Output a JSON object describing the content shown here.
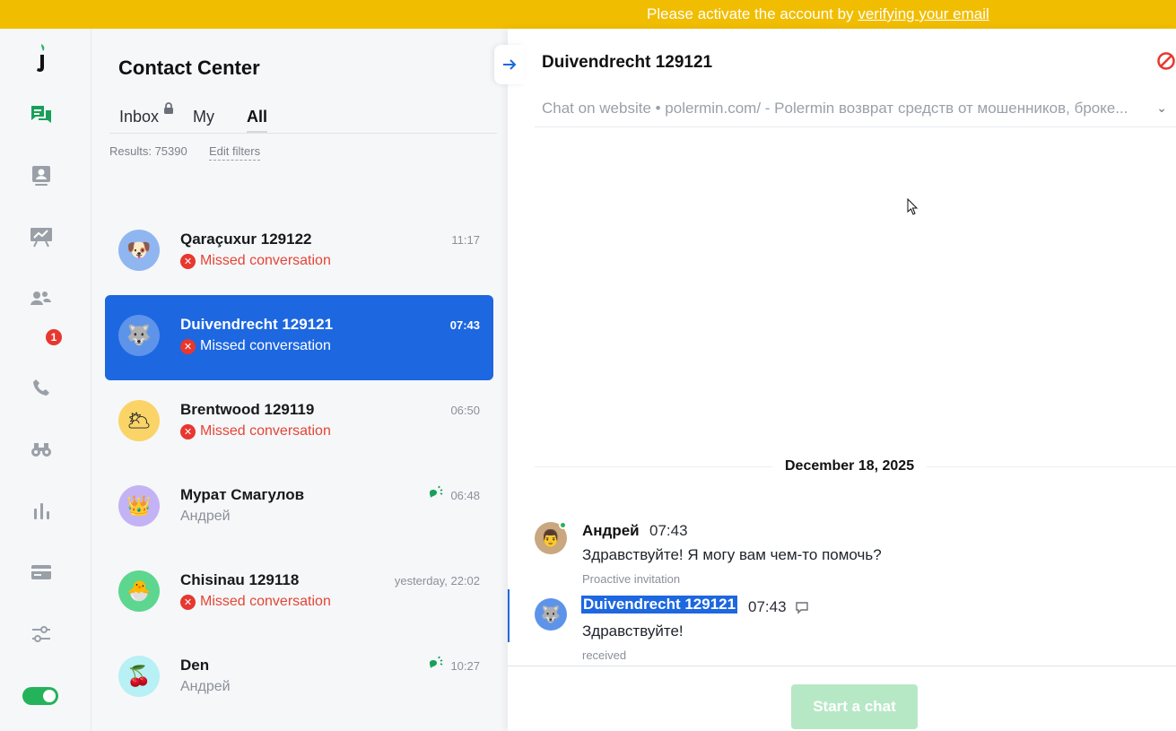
{
  "banner": {
    "text": "Please activate the account by ",
    "link": "verifying your email"
  },
  "sidebar": {
    "logo": "j",
    "items": [
      {
        "icon": "chat-icon",
        "active": true
      },
      {
        "icon": "contact-card-icon"
      },
      {
        "icon": "presentation-chart-icon"
      },
      {
        "icon": "team-icon",
        "badge": "1"
      },
      {
        "icon": "phone-icon"
      },
      {
        "icon": "binoculars-icon"
      },
      {
        "icon": "bar-chart-icon"
      },
      {
        "icon": "credit-card-icon"
      },
      {
        "icon": "settings-sliders-icon"
      }
    ],
    "status_toggle": "on",
    "accent": "#24b35b"
  },
  "contact_center": {
    "title": "Contact Center",
    "tabs": [
      {
        "label": "Inbox",
        "locked": true
      },
      {
        "label": "My"
      },
      {
        "label": "All",
        "active": true
      }
    ],
    "results": "Results: 75390",
    "edit_filters": "Edit filters",
    "conversations": [
      {
        "name": "Qaraçuxur 129122",
        "time": "11:17",
        "sub": "Missed conversation",
        "missed": true,
        "avatar": "🐶",
        "avatar_bg": "#8fb6f0"
      },
      {
        "name": "Duivendrecht 129121",
        "time": "07:43",
        "sub": "Missed conversation",
        "missed": true,
        "avatar": "🐺",
        "avatar_bg": "#5d94ea",
        "selected": true
      },
      {
        "name": "Brentwood 129119",
        "time": "06:50",
        "sub": "Missed conversation",
        "missed": true,
        "avatar": "🌥",
        "avatar_bg": "#fbd467"
      },
      {
        "name": "Мурат Смагулов",
        "time": "06:48",
        "sub": "Андрей",
        "missed": false,
        "avatar": "👑",
        "avatar_bg": "#c3b3f5",
        "typing": true
      },
      {
        "name": "Chisinau 129118",
        "time": "yesterday, 22:02",
        "sub": "Missed conversation",
        "missed": true,
        "avatar": "🐣",
        "avatar_bg": "#5dd68f"
      },
      {
        "name": "Den",
        "time": "10:27",
        "sub": "Андрей",
        "missed": false,
        "avatar": "🍒",
        "avatar_bg": "#b7f0f5",
        "typing": true
      }
    ]
  },
  "chat": {
    "title": "Duivendrecht 129121",
    "channel": "Chat on website • polermin.com/ - Polermin возврат средств от мошенников, броке...",
    "date": "December 18, 2025",
    "messages": [
      {
        "author": "Андрей",
        "time": "07:43",
        "text": "Здравствуйте! Я могу вам чем-то помочь?",
        "meta": "Proactive invitation",
        "avatar": "👨"
      },
      {
        "author": "Duivendrecht 129121",
        "time": "07:43",
        "text": "Здравствуйте!",
        "meta": "received",
        "avatar": "🐺"
      }
    ],
    "start_button": "Start a chat"
  }
}
